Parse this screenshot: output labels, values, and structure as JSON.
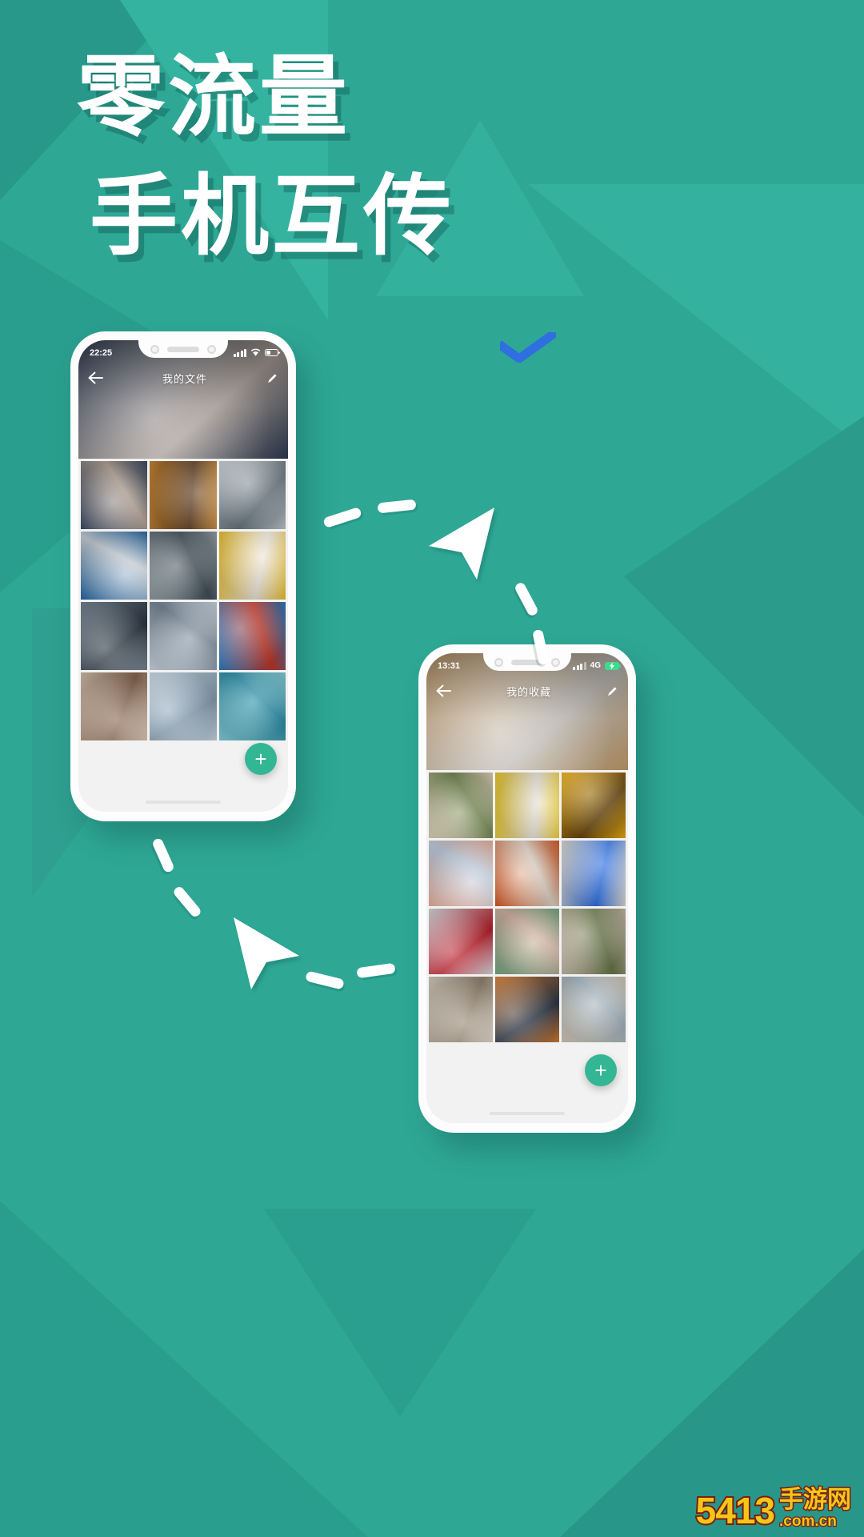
{
  "poster": {
    "background_color": "#2fa795",
    "headline_line1": "零流量",
    "headline_line2": "手机互传"
  },
  "decorations": {
    "check_icon": "check-mark",
    "cursor_icon": "arrow-cursor",
    "check_color": "#2f6fe0"
  },
  "phone_left": {
    "status": {
      "time": "22:25",
      "signal_icon": "signal-bars",
      "wifi_icon": "wifi",
      "battery_icon": "battery",
      "network_label": ""
    },
    "appbar": {
      "back_icon": "back-arrow",
      "title": "我的文件",
      "edit_icon": "pencil"
    },
    "fab": {
      "label": "+",
      "color": "#33b694"
    },
    "grid": {
      "rows": 4,
      "columns": 3,
      "photos": [
        {
          "name": "couple-in-sweaters",
          "c1": "#3d4b63",
          "c2": "#b9a99c"
        },
        {
          "name": "couple-string-lights",
          "c1": "#c98b3c",
          "c2": "#5b3a1e"
        },
        {
          "name": "snowy-forest-path",
          "c1": "#c7cfd6",
          "c2": "#6d7a84"
        },
        {
          "name": "blue-snowboard",
          "c1": "#2f6ea8",
          "c2": "#cfd8df"
        },
        {
          "name": "winter-walk-trees",
          "c1": "#9aa7ad",
          "c2": "#45525c"
        },
        {
          "name": "woman-yellow-coat",
          "c1": "#f2c93b",
          "c2": "#efe7dc"
        },
        {
          "name": "jumping-person-snow",
          "c1": "#7d8b97",
          "c2": "#2d3944"
        },
        {
          "name": "two-snowboarders",
          "c1": "#d6e2ec",
          "c2": "#7d8d9b"
        },
        {
          "name": "snowboarder-red-jacket",
          "c1": "#2f7fc4",
          "c2": "#c0392b"
        },
        {
          "name": "friends-lying-down",
          "c1": "#d8c4b2",
          "c2": "#8a6a55"
        },
        {
          "name": "snowy-mountain",
          "c1": "#cfe0ec",
          "c2": "#8fa4b6"
        },
        {
          "name": "tropical-beach",
          "c1": "#8fd6e0",
          "c2": "#2f8fa8"
        }
      ],
      "hero_photo": {
        "name": "couple-hugging-hero",
        "c1": "#2e3b52",
        "c2": "#b5aaa2"
      }
    }
  },
  "phone_right": {
    "status": {
      "time": "13:31",
      "signal_icon": "signal-bars",
      "network_label": "4G",
      "battery_icon": "battery-charging",
      "battery_color": "#3ddc8c"
    },
    "appbar": {
      "back_icon": "back-arrow",
      "title": "我的收藏",
      "edit_icon": "pencil"
    },
    "fab": {
      "label": "+",
      "color": "#33b694"
    },
    "grid": {
      "rows": 4,
      "columns": 3,
      "photos": [
        {
          "name": "breakfast-flatlay",
          "c1": "#e8d9c3",
          "c2": "#7a8f5a"
        },
        {
          "name": "woman-with-please-sign",
          "c1": "#f2d23a",
          "c2": "#e8e4dc"
        },
        {
          "name": "sunflower",
          "c1": "#f0b31c",
          "c2": "#6b4a12"
        },
        {
          "name": "pink-clouds",
          "c1": "#f2b9a8",
          "c2": "#c9d8e8"
        },
        {
          "name": "woman-orange-dress",
          "c1": "#d9602b",
          "c2": "#e8dcd0"
        },
        {
          "name": "yellow-blue-flag",
          "c1": "#e8e4dc",
          "c2": "#2f6fe0"
        },
        {
          "name": "rose-on-shirt",
          "c1": "#e0e4e8",
          "c2": "#b8202c"
        },
        {
          "name": "green-hair-portrait",
          "c1": "#7fae8a",
          "c2": "#d8b9a8"
        },
        {
          "name": "flowers-and-food",
          "c1": "#cdbfae",
          "c2": "#6c7a4e"
        },
        {
          "name": "hands-in-sweater",
          "c1": "#ded5c8",
          "c2": "#9a8a78"
        },
        {
          "name": "desert-road",
          "c1": "#d8813a",
          "c2": "#2f3a4a"
        },
        {
          "name": "arch-doorway",
          "c1": "#ddd3c2",
          "c2": "#a8b9c4"
        }
      ],
      "hero_photo": {
        "name": "pastry-flatlay-hero",
        "c1": "#c9a271",
        "c2": "#d0cdc8"
      }
    }
  },
  "watermark": {
    "number": "5413",
    "site": "手游网",
    "domain": ".com.cn"
  }
}
